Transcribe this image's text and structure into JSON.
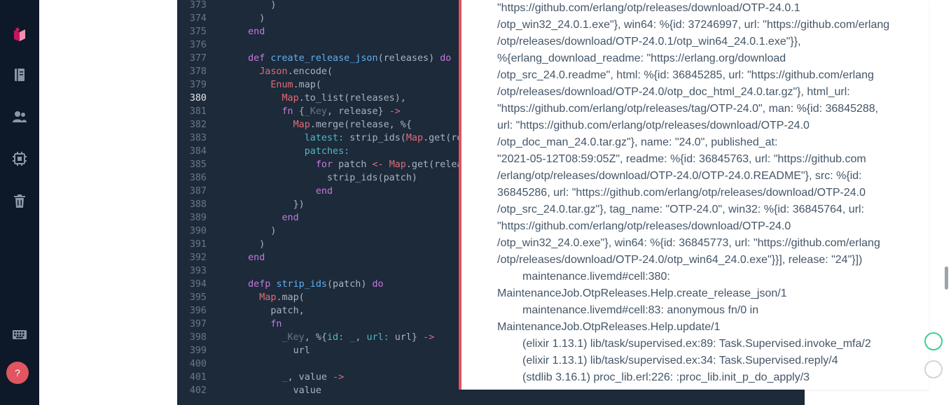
{
  "sidebar": {
    "items": [
      {
        "name": "livebook-logo",
        "icon": "notebook-logo-icon"
      },
      {
        "name": "notebooks",
        "icon": "book-icon"
      },
      {
        "name": "users",
        "icon": "users-icon"
      },
      {
        "name": "runtime",
        "icon": "cpu-chip-icon"
      },
      {
        "name": "bin",
        "icon": "trash-icon"
      },
      {
        "name": "shortcuts",
        "icon": "keyboard-icon"
      }
    ],
    "help_label": "?"
  },
  "editor": {
    "active_line": "380",
    "lines": [
      {
        "n": "373",
        "segs": [
          [
            "p",
            "      )"
          ]
        ]
      },
      {
        "n": "374",
        "segs": [
          [
            "p",
            "    )"
          ]
        ]
      },
      {
        "n": "375",
        "segs": [
          [
            "k",
            "  end"
          ]
        ]
      },
      {
        "n": "376",
        "segs": []
      },
      {
        "n": "377",
        "segs": [
          [
            "k",
            "  def "
          ],
          [
            "f",
            "create_release_json"
          ],
          [
            "p",
            "(releases) "
          ],
          [
            "k",
            "do"
          ]
        ]
      },
      {
        "n": "378",
        "segs": [
          [
            "m",
            "    Jason"
          ],
          [
            "p",
            ".encode("
          ]
        ]
      },
      {
        "n": "379",
        "segs": [
          [
            "m",
            "      Enum"
          ],
          [
            "p",
            ".map("
          ]
        ]
      },
      {
        "n": "380",
        "segs": [
          [
            "m",
            "        Map"
          ],
          [
            "p",
            ".to_list(releases),"
          ]
        ]
      },
      {
        "n": "381",
        "segs": [
          [
            "k",
            "        fn "
          ],
          [
            "p",
            "{"
          ],
          [
            "c",
            "_Key"
          ],
          [
            "p",
            ", release} "
          ],
          [
            "o",
            "->"
          ]
        ]
      },
      {
        "n": "382",
        "segs": [
          [
            "m",
            "          Map"
          ],
          [
            "p",
            ".merge(release, %{"
          ]
        ]
      },
      {
        "n": "383",
        "segs": [
          [
            "a",
            "            latest: "
          ],
          [
            "p",
            "strip_ids("
          ],
          [
            "m",
            "Map"
          ],
          [
            "p",
            ".get(re"
          ]
        ]
      },
      {
        "n": "384",
        "segs": [
          [
            "a",
            "            patches:"
          ]
        ]
      },
      {
        "n": "385",
        "segs": [
          [
            "k",
            "              for "
          ],
          [
            "p",
            "patch "
          ],
          [
            "o",
            "<- "
          ],
          [
            "m",
            "Map"
          ],
          [
            "p",
            ".get(relea"
          ]
        ]
      },
      {
        "n": "386",
        "segs": [
          [
            "p",
            "                strip_ids(patch)"
          ]
        ]
      },
      {
        "n": "387",
        "segs": [
          [
            "k",
            "              end"
          ]
        ]
      },
      {
        "n": "388",
        "segs": [
          [
            "p",
            "          })"
          ]
        ]
      },
      {
        "n": "389",
        "segs": [
          [
            "k",
            "        end"
          ]
        ]
      },
      {
        "n": "390",
        "segs": [
          [
            "p",
            "      )"
          ]
        ]
      },
      {
        "n": "391",
        "segs": [
          [
            "p",
            "    )"
          ]
        ]
      },
      {
        "n": "392",
        "segs": [
          [
            "k",
            "  end"
          ]
        ]
      },
      {
        "n": "393",
        "segs": []
      },
      {
        "n": "394",
        "segs": [
          [
            "k",
            "  defp "
          ],
          [
            "f",
            "strip_ids"
          ],
          [
            "p",
            "(patch) "
          ],
          [
            "k",
            "do"
          ]
        ]
      },
      {
        "n": "395",
        "segs": [
          [
            "m",
            "    Map"
          ],
          [
            "p",
            ".map("
          ]
        ]
      },
      {
        "n": "396",
        "segs": [
          [
            "p",
            "      patch,"
          ]
        ]
      },
      {
        "n": "397",
        "segs": [
          [
            "k",
            "      fn"
          ]
        ]
      },
      {
        "n": "398",
        "segs": [
          [
            "c",
            "        _Key"
          ],
          [
            "p",
            ", %{"
          ],
          [
            "a",
            "id: "
          ],
          [
            "c",
            "_"
          ],
          [
            "p",
            ", "
          ],
          [
            "a",
            "url: "
          ],
          [
            "p",
            "url} "
          ],
          [
            "o",
            "->"
          ]
        ]
      },
      {
        "n": "399",
        "segs": [
          [
            "p",
            "          url"
          ]
        ]
      },
      {
        "n": "400",
        "segs": []
      },
      {
        "n": "401",
        "segs": [
          [
            "c",
            "        _"
          ],
          [
            "p",
            ", value "
          ],
          [
            "o",
            "->"
          ]
        ]
      },
      {
        "n": "402",
        "segs": [
          [
            "p",
            "          value"
          ]
        ]
      }
    ]
  },
  "error_output": {
    "lines": [
      {
        "indent": false,
        "text": "\"https://github.com/erlang/otp/releases/download/OTP-24.0.1"
      },
      {
        "indent": false,
        "text": "/otp_win32_24.0.1.exe\"}, win64: %{id: 37246997, url: \"https://github.com/erlang"
      },
      {
        "indent": false,
        "text": "/otp/releases/download/OTP-24.0.1/otp_win64_24.0.1.exe\"}},"
      },
      {
        "indent": false,
        "text": "%{erlang_download_readme: \"https://erlang.org/download"
      },
      {
        "indent": false,
        "text": "/otp_src_24.0.readme\", html: %{id: 36845285, url: \"https://github.com/erlang"
      },
      {
        "indent": false,
        "text": "/otp/releases/download/OTP-24.0/otp_doc_html_24.0.tar.gz\"}, html_url:"
      },
      {
        "indent": false,
        "text": "\"https://github.com/erlang/otp/releases/tag/OTP-24.0\", man: %{id: 36845288,"
      },
      {
        "indent": false,
        "text": "url: \"https://github.com/erlang/otp/releases/download/OTP-24.0"
      },
      {
        "indent": false,
        "text": "/otp_doc_man_24.0.tar.gz\"}, name: \"24.0\", published_at:"
      },
      {
        "indent": false,
        "text": "\"2021-05-12T08:59:05Z\", readme: %{id: 36845763, url: \"https://github.com"
      },
      {
        "indent": false,
        "text": "/erlang/otp/releases/download/OTP-24.0/OTP-24.0.README\"}, src: %{id:"
      },
      {
        "indent": false,
        "text": "36845286, url: \"https://github.com/erlang/otp/releases/download/OTP-24.0"
      },
      {
        "indent": false,
        "text": "/otp_src_24.0.tar.gz\"}, tag_name: \"OTP-24.0\", win32: %{id: 36845764, url:"
      },
      {
        "indent": false,
        "text": "\"https://github.com/erlang/otp/releases/download/OTP-24.0"
      },
      {
        "indent": false,
        "text": "/otp_win32_24.0.exe\"}, win64: %{id: 36845773, url: \"https://github.com/erlang"
      },
      {
        "indent": false,
        "text": "/otp/releases/download/OTP-24.0/otp_win64_24.0.exe\"}}], release: \"24\"}])"
      },
      {
        "indent": true,
        "text": "maintenance.livemd#cell:380:"
      },
      {
        "indent": false,
        "text": "MaintenanceJob.OtpReleases.Help.create_release_json/1"
      },
      {
        "indent": true,
        "text": "maintenance.livemd#cell:83: anonymous fn/0 in"
      },
      {
        "indent": false,
        "text": "MaintenanceJob.OtpReleases.Help.update/1"
      },
      {
        "indent": true,
        "text": "(elixir 1.13.1) lib/task/supervised.ex:89: Task.Supervised.invoke_mfa/2"
      },
      {
        "indent": true,
        "text": "(elixir 1.13.1) lib/task/supervised.ex:34: Task.Supervised.reply/4"
      },
      {
        "indent": true,
        "text": "(stdlib 3.16.1) proc_lib.erl:226: :proc_lib.init_p_do_apply/3"
      }
    ]
  },
  "colors": {
    "sidebar_bg": "#0d1829",
    "editor_bg": "#1c2a3a",
    "error_accent": "#e0555f",
    "status_green": "#3ecf8e"
  }
}
